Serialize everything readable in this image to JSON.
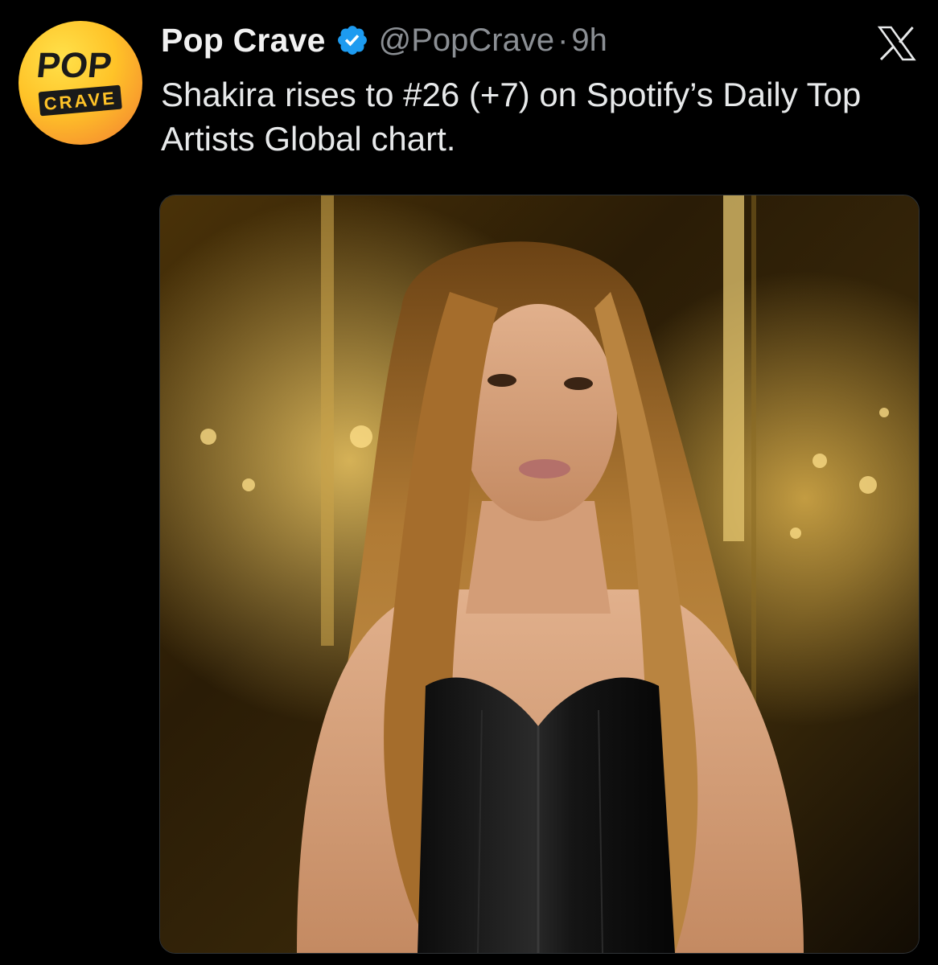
{
  "tweet": {
    "author": {
      "display_name": "Pop Crave",
      "handle": "@PopCrave",
      "verified": true,
      "avatar_text_top": "POP",
      "avatar_text_bottom": "CRAVE"
    },
    "separator": "·",
    "timestamp": "9h",
    "text": "Shakira rises to #26 (+7) on Spotify’s Daily Top Artists Global chart.",
    "media": {
      "type": "photo"
    }
  },
  "icons": {
    "verified": "verified-badge-icon",
    "platform": "x-logo-icon"
  },
  "colors": {
    "background": "#000000",
    "text": "#e7e9ea",
    "secondary_text": "#8b8f94",
    "verified_blue": "#1d9bf0",
    "avatar_yellow": "#ffc328",
    "avatar_orange": "#f07a3a"
  }
}
